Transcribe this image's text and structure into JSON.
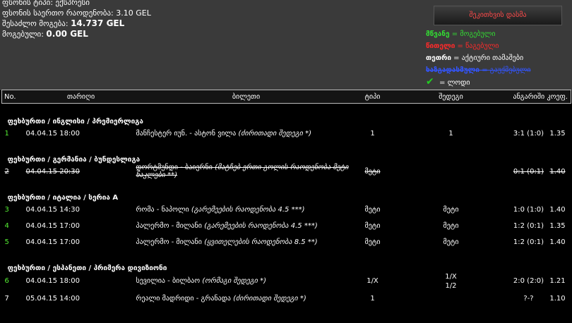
{
  "summary": {
    "line1_label": "ფსონის ტიპი:",
    "line1_value": "ექსპრესი",
    "line2_label": "ფსონის საერთო რაოდენობა:",
    "line2_value": "3.10 GEL",
    "line3_label": "შესაძლო მოგება:",
    "line3_value": "14.737 GEL",
    "line4_label": "მოგებული:",
    "line4_value": "0.00 GEL"
  },
  "combo_button": "შეკითხვის დასმა",
  "legend": {
    "win_word": "მწვანე",
    "win_text": " = მოგებული",
    "lose_word": "წითელი",
    "lose_text": " = წაგებული",
    "active_word": "თეთრი",
    "active_text": " = აქტიური თამაშები",
    "cancel_word": "ხაზგადასმული",
    "cancel_text": " = გაუქმებული",
    "check_text": " = ლოდი"
  },
  "colors": {
    "win": "#55ee33",
    "lose": "#ff2a2a",
    "cancel": "#3344ff",
    "active": "#ffffff"
  },
  "table": {
    "headers": [
      "No.",
      "თარიღი",
      "ბილეთი",
      "ტიპი",
      "შედეგი",
      "ანგარიში",
      "კოეფ."
    ],
    "sections": [
      {
        "title": "ფეხბურთი / ინგლისი / პრემიერლიგა",
        "rows": [
          {
            "no": "1",
            "date": "04.04.15 18:00",
            "match": "მანჩესტერ იუნ. - ასტონ ვილა",
            "note": "(ძირითადი შედეგი *)",
            "type": "1",
            "result": "1",
            "score": "3:1 (1:0)",
            "odds": "1.35",
            "status": "green"
          }
        ]
      },
      {
        "title": "ფეხბურთი / გერმანია / ბუნდესლიგა",
        "rows": [
          {
            "no": "2",
            "date": "04.04.15 20:30",
            "match": "დორტმუნდი - ბაიერნი",
            "note": "(მატჩებ ერთი გოლის რაოდენობა მეტი ნაკლები **)",
            "type": "მეტი",
            "result": "",
            "score": "0:1 (0:1)",
            "odds": "1.40",
            "status": "blue"
          }
        ]
      },
      {
        "title": "ფეხბურთი / იტალია / სერია A",
        "rows": [
          {
            "no": "3",
            "date": "04.04.15 14:30",
            "match": "რომა - ნაპოლი",
            "note": "(გარემეების რაოდენობა 4.5 ***)",
            "type": "მეტი",
            "result": "მეტი",
            "score": "1:0 (1:0)",
            "odds": "1.40",
            "status": "green"
          },
          {
            "no": "4",
            "date": "04.04.15 17:00",
            "match": "პალერმო - მილანი",
            "note": "(გარემეების რაოდენობა 4.5 ***)",
            "type": "მეტი",
            "result": "მეტი",
            "score": "1:2 (0:1)",
            "odds": "1.35",
            "status": "green"
          },
          {
            "no": "5",
            "date": "04.04.15 17:00",
            "match": "პალერმო - მილანი",
            "note": "(ყვითელების რაოდენობა 8.5 **)",
            "type": "მეტი",
            "result": "მეტი",
            "score": "1:2 (0:1)",
            "odds": "1.40",
            "status": "green"
          }
        ]
      },
      {
        "title": "ფეხბურთი / ესპანეთი / პრიმერა დივიზიონი",
        "rows": [
          {
            "no": "6",
            "date": "04.04.15 18:00",
            "match": "სევილია - ბილბაო",
            "note": "(ორმაგი შედეგი *)",
            "type": "1/X",
            "result": "1/X\n1/2",
            "score": "2:0 (2:0)",
            "odds": "1.21",
            "status": "green"
          },
          {
            "no": "7",
            "date": "05.04.15 14:00",
            "match": "რეალი მადრიდი - გრანადა",
            "note": "(ძირითადი შედეგი *)",
            "type": "1",
            "result": "",
            "score": "?-?",
            "odds": "1.10",
            "status": "white"
          }
        ]
      }
    ]
  }
}
